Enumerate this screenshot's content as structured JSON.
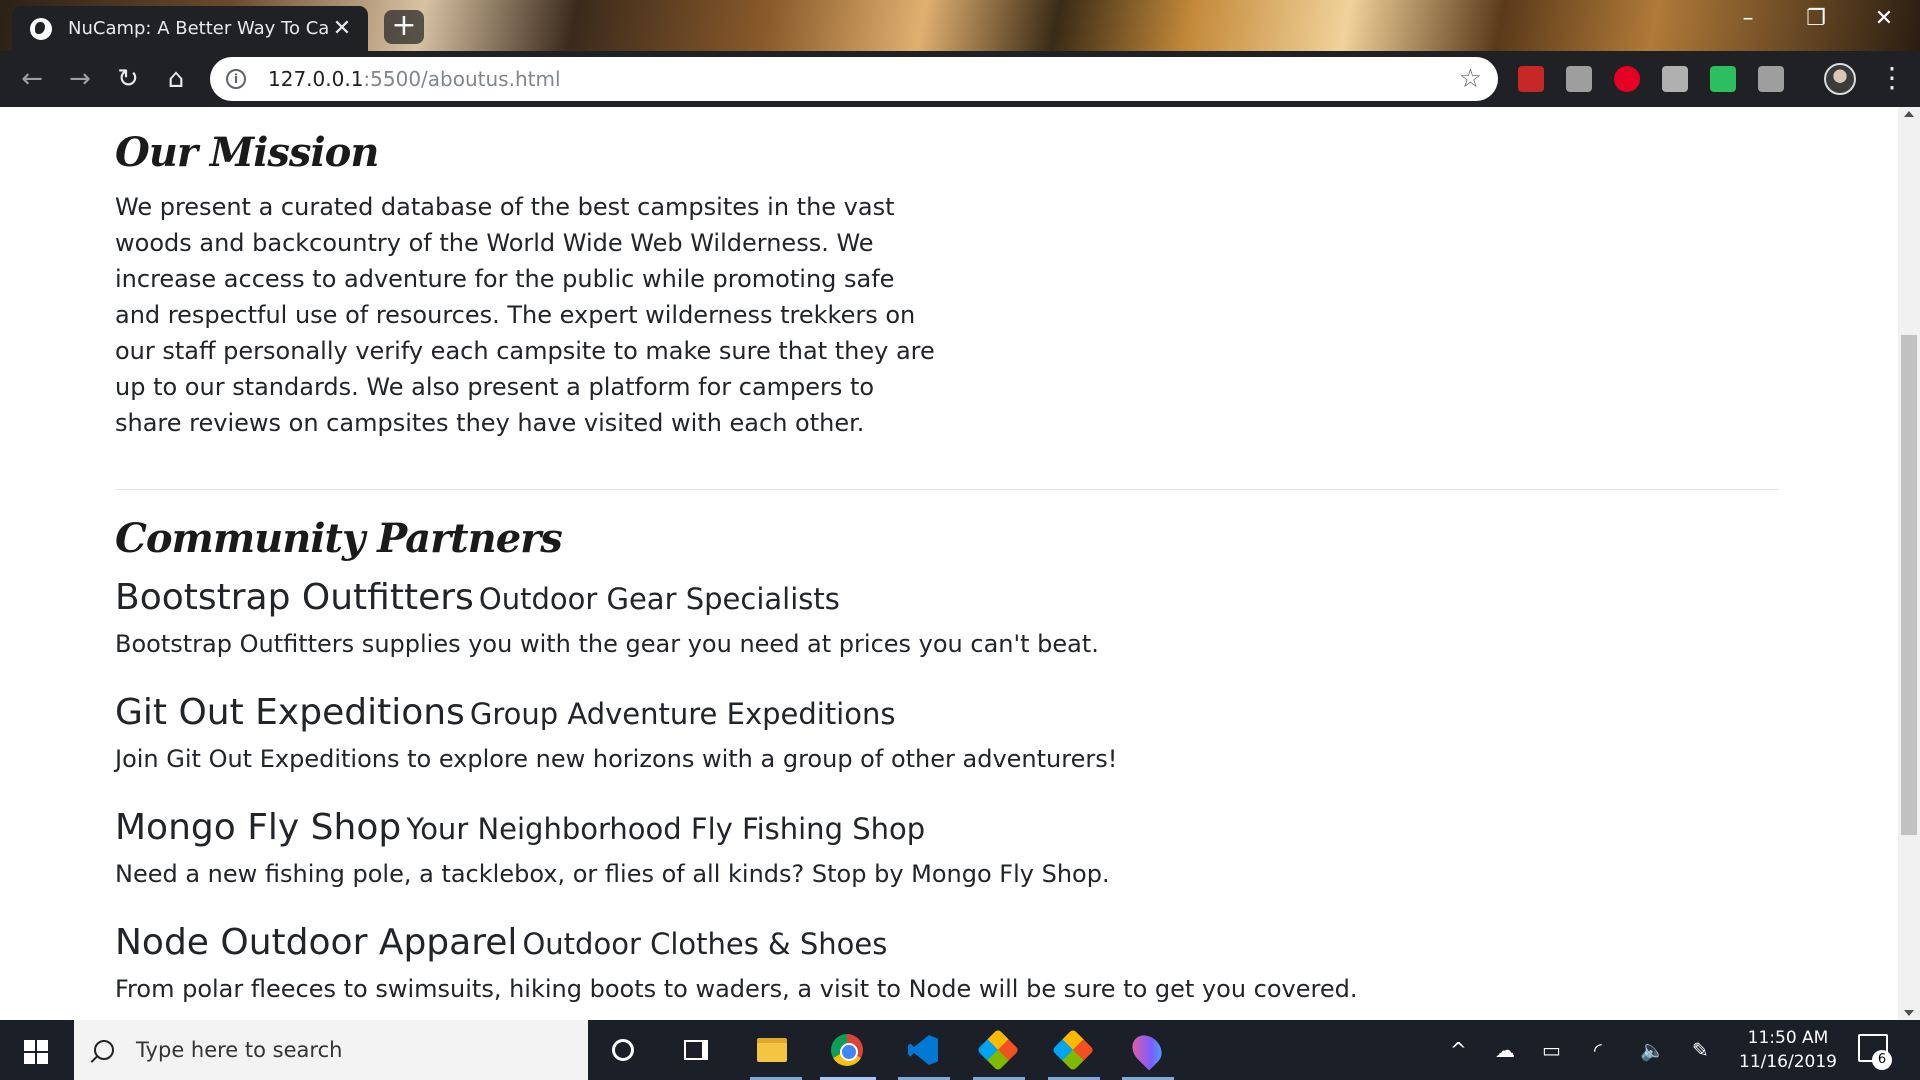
{
  "browser": {
    "tab_title": "NuCamp: A Better Way To Camp",
    "tab_close": "✕",
    "new_tab": "+",
    "url_host": "127.0.0.1",
    "url_rest": ":5500/aboutus.html",
    "back": "←",
    "forward": "→",
    "reload": "↻",
    "home": "⌂",
    "minimize": "–",
    "maximize": "❐",
    "close": "✕",
    "extensions": [
      {
        "name": "bookmark-extension-icon",
        "color": "#c62828"
      },
      {
        "name": "download-extension-icon",
        "color": "#9e9e9e"
      },
      {
        "name": "pinterest-icon",
        "color": "#e60023"
      },
      {
        "name": "dropbox-icon",
        "color": "#b0b0b0"
      },
      {
        "name": "evernote-extension-icon",
        "color": "#2dbe60"
      },
      {
        "name": "css-extension-icon",
        "color": "#9e9e9e"
      }
    ]
  },
  "page": {
    "mission": {
      "title": "Our Mission",
      "text": "We present a curated database of the best campsites in the vast woods and backcountry of the World Wide Web Wilderness. We increase access to adventure for the public while promoting safe and respectful use of resources. The expert wilderness trekkers on our staff personally verify each campsite to make sure that they are up to our standards. We also present a platform for campers to share reviews on campsites they have visited with each other."
    },
    "partners": {
      "title": "Community Partners",
      "items": [
        {
          "name": "Bootstrap Outfitters",
          "tagline": "Outdoor Gear Specialists",
          "description": "Bootstrap Outfitters supplies you with the gear you need at prices you can't beat."
        },
        {
          "name": "Git Out Expeditions",
          "tagline": "Group Adventure Expeditions",
          "description": "Join Git Out Expeditions to explore new horizons with a group of other adventurers!"
        },
        {
          "name": "Mongo Fly Shop",
          "tagline": "Your Neighborhood Fly Fishing Shop",
          "description": "Need a new fishing pole, a tacklebox, or flies of all kinds? Stop by Mongo Fly Shop."
        },
        {
          "name": "Node Outdoor Apparel",
          "tagline": "Outdoor Clothes & Shoes",
          "description": "From polar fleeces to swimsuits, hiking boots to waders, a visit to Node will be sure to get you covered."
        }
      ]
    }
  },
  "taskbar": {
    "search_placeholder": "Type here to search",
    "time": "11:50 AM",
    "date": "11/16/2019",
    "notification_count": "6",
    "tray_chevron": "^"
  }
}
